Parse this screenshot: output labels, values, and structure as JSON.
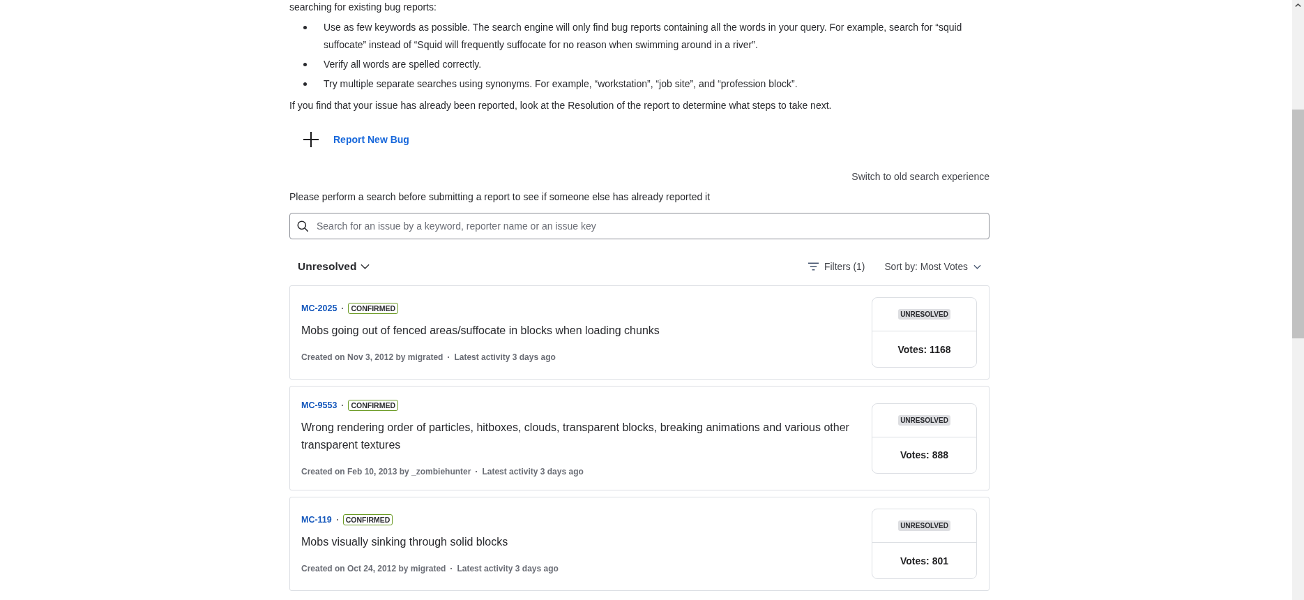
{
  "intro": {
    "lead": "searching for existing bug reports:",
    "tips": [
      "Use as few keywords as possible. The search engine will only find bug reports containing all the words in your query. For example, search for “squid suffocate” instead of “Squid will frequently suffocate for no reason when swimming around in a river”.",
      "Verify all words are spelled correctly.",
      "Try multiple separate searches using synonyms. For example, “workstation”, “job site”, and “profession block”."
    ],
    "closing": "If you find that your issue has already been reported, look at the Resolution of the report to determine what steps to take next."
  },
  "report_button": {
    "label": "Report New Bug"
  },
  "switch_link": {
    "label": "Switch to old search experience"
  },
  "search_prompt": "Please perform a search before submitting a report to see if someone else has already reported it",
  "search": {
    "placeholder": "Search for an issue by a keyword, reporter name or an issue key"
  },
  "toolbar": {
    "resolution_filter": "Unresolved",
    "filters": "Filters (1)",
    "sort": "Sort by: Most Votes"
  },
  "issues": [
    {
      "key": "MC-2025",
      "status": "CONFIRMED",
      "title": "Mobs going out of fenced areas/suffocate in blocks when loading chunks",
      "created": "Created on Nov 3, 2012 by migrated",
      "activity": "Latest activity 3 days ago",
      "resolution": "UNRESOLVED",
      "votes": "Votes: 1168"
    },
    {
      "key": "MC-9553",
      "status": "CONFIRMED",
      "title": "Wrong rendering order of particles, hitboxes, clouds, transparent blocks, breaking animations and various other transparent textures",
      "created": "Created on Feb 10, 2013 by _zombiehunter",
      "activity": "Latest activity 3 days ago",
      "resolution": "UNRESOLVED",
      "votes": "Votes: 888"
    },
    {
      "key": "MC-119",
      "status": "CONFIRMED",
      "title": "Mobs visually sinking through solid blocks",
      "created": "Created on Oct 24, 2012 by migrated",
      "activity": "Latest activity 3 days ago",
      "resolution": "UNRESOLVED",
      "votes": "Votes: 801"
    }
  ]
}
